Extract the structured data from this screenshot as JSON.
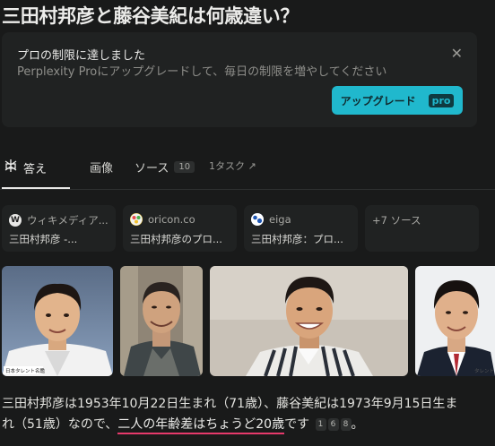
{
  "question": "三田村邦彦と藤谷美紀は何歳違い？",
  "banner": {
    "title": "プロの制限に達しました",
    "text": "Perplexity Proにアップグレードして、毎日の制限を増やしてください",
    "close_icon": "close-icon",
    "button_label": "アップグレード",
    "button_badge": "pro",
    "accent_color": "#20b8cd"
  },
  "tabs": {
    "answer_label": "答え",
    "images_label": "画像",
    "sources_label": "ソース",
    "sources_count": "10",
    "task_label": "1タスク ↗"
  },
  "sources": [
    {
      "site": "ウィキメディア...",
      "title": "三田村邦彦 -...",
      "icon": "wikipedia-icon"
    },
    {
      "site": "oricon.co",
      "title": "三田村邦彦のプロ...",
      "icon": "oricon-icon"
    },
    {
      "site": "eiga",
      "title": "三田村邦彦：プロ...",
      "icon": "eiga-icon"
    }
  ],
  "more_sources": "+7 ソース",
  "photos": [
    {
      "caption": "日本タレント名鑑"
    },
    {
      "caption": ""
    },
    {
      "caption": ""
    },
    {
      "caption": "タレント"
    }
  ],
  "answer": {
    "line1": "三田村邦彦は1953年10月22日生まれ（71歳）、藤谷美紀は1973年9月15日生ま",
    "line2_pre": "れ（51歳）なので、",
    "line2_highlight": "二人の年齢差はちょうど20歳",
    "line2_post": "です",
    "citations": [
      "1",
      "6",
      "8"
    ],
    "end": "。"
  }
}
